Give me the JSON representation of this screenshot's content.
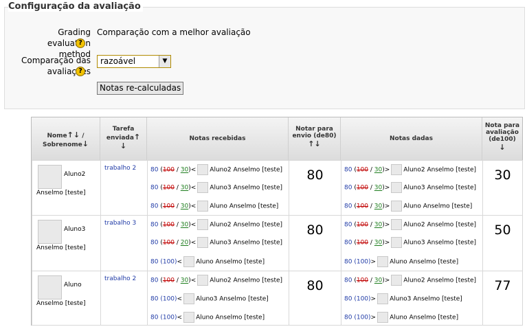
{
  "section": {
    "title": "Configuração da avaliação",
    "method_label_1": "Grading evaluation",
    "method_label_2": "method",
    "method_value": "Comparação com a melhor avaliação",
    "compare_label_1": "Comparação das",
    "compare_label_2": "avaliações",
    "compare_selected": "razoável",
    "recalc_button": "Notas re-calculadas"
  },
  "table": {
    "headers": {
      "name_1": "Nome",
      "name_2": "/",
      "name_3": "Sobrenome",
      "task_1": "Tarefa",
      "task_2": "enviada",
      "received": "Notas recebidas",
      "send_1": "Notar para",
      "send_2": "envio (de80)",
      "given": "Notas dadas",
      "eval_1": "Nota para",
      "eval_2": "avaliação",
      "eval_3": "(de100)"
    },
    "rows": [
      {
        "student_first": "Aluno2",
        "student_last": "Anselmo [teste]",
        "task": "trabalho 2",
        "send_grade": "80",
        "eval_grade": "30",
        "received": [
          {
            "score": "80",
            "orig": "100",
            "new": "30",
            "who": "Aluno2 Anselmo [teste]"
          },
          {
            "score": "80",
            "orig": "100",
            "new": "30",
            "who": "Aluno3 Anselmo [teste]"
          },
          {
            "score": "80",
            "orig": "100",
            "new": "30",
            "who": "Aluno Anselmo [teste]"
          }
        ],
        "given": [
          {
            "score": "80",
            "orig": "100",
            "new": "30",
            "who": "Aluno2 Anselmo [teste]"
          },
          {
            "score": "80",
            "orig": "100",
            "new": "30",
            "who": "Aluno3 Anselmo [teste]"
          },
          {
            "score": "80",
            "orig": "100",
            "new": "30",
            "who": "Aluno Anselmo [teste]"
          }
        ]
      },
      {
        "student_first": "Aluno3",
        "student_last": "Anselmo [teste]",
        "task": "trabalho 3",
        "send_grade": "80",
        "eval_grade": "50",
        "received": [
          {
            "score": "80",
            "orig": "100",
            "new": "30",
            "who": "Aluno2 Anselmo [teste]"
          },
          {
            "score": "80",
            "orig": "100",
            "new": "20",
            "who": "Aluno3 Anselmo [teste]"
          },
          {
            "score": "80",
            "plain": "100",
            "who": "Aluno Anselmo [teste]"
          }
        ],
        "given": [
          {
            "score": "80",
            "orig": "100",
            "new": "30",
            "who": "Aluno2 Anselmo [teste]"
          },
          {
            "score": "80",
            "orig": "100",
            "new": "30",
            "who": "Aluno3 Anselmo [teste]"
          },
          {
            "score": "80",
            "plain": "100",
            "who": "Aluno Anselmo [teste]"
          }
        ]
      },
      {
        "student_first": "Aluno",
        "student_last": "Anselmo [teste]",
        "task": "trabalho 2",
        "send_grade": "80",
        "eval_grade": "77",
        "received": [
          {
            "score": "80",
            "orig": "100",
            "new": "30",
            "who": "Aluno2 Anselmo [teste]"
          },
          {
            "score": "80",
            "plain": "100",
            "who": "Aluno3 Anselmo [teste]"
          },
          {
            "score": "80",
            "plain": "100",
            "who": "Aluno Anselmo [teste]"
          }
        ],
        "given": [
          {
            "score": "80",
            "orig": "100",
            "new": "30",
            "who": "Aluno2 Anselmo [teste]"
          },
          {
            "score": "80",
            "plain": "100",
            "who": "Aluno3 Anselmo [teste]"
          },
          {
            "score": "80",
            "plain": "100",
            "who": "Aluno Anselmo [teste]"
          }
        ]
      }
    ]
  }
}
